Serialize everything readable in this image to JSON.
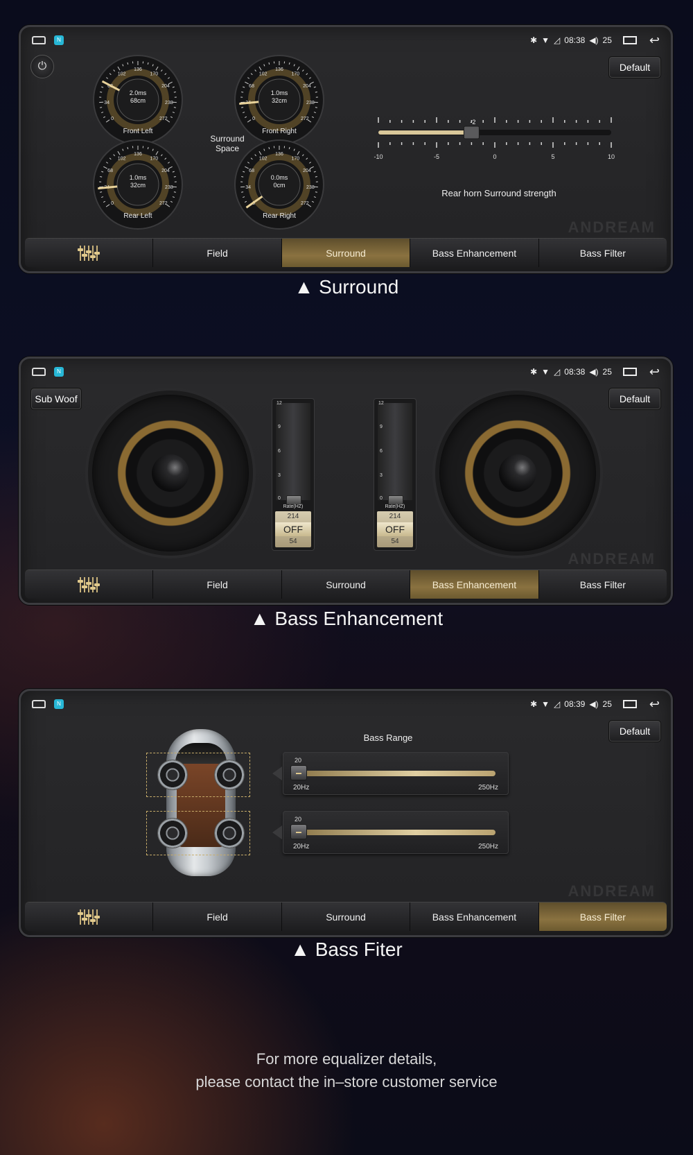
{
  "status": {
    "time_1": "08:38",
    "time_2": "08:38",
    "time_3": "08:39",
    "volume": "25",
    "app_icon_text": "N"
  },
  "common": {
    "default_label": "Default",
    "tabs": [
      "Field",
      "Surround",
      "Bass Enhancement",
      "Bass Filter"
    ],
    "watermark": "ANDREAM"
  },
  "surround": {
    "dials": [
      {
        "name": "Front Left",
        "time": "2.0ms",
        "distance": "68cm",
        "value": 68
      },
      {
        "name": "Front Right",
        "time": "1.0ms",
        "distance": "32cm",
        "value": 32
      },
      {
        "name": "Rear Left",
        "time": "1.0ms",
        "distance": "32cm",
        "value": 32
      },
      {
        "name": "Rear Right",
        "time": "0.0ms",
        "distance": "0cm",
        "value": 0
      }
    ],
    "dial_ticks": [
      "0",
      "34",
      "68",
      "102",
      "136",
      "170",
      "204",
      "238",
      "272"
    ],
    "space_label_line1": "Surround",
    "space_label_line2": "Space",
    "strength_value": "-2",
    "strength": -2,
    "strength_ticks": [
      "-10",
      "-5",
      "0",
      "5",
      "10"
    ],
    "strength_label": "Rear horn Surround strength"
  },
  "bass_enhancement": {
    "subwoof_label": "Sub Woof",
    "fader_ticks": [
      "12",
      "9",
      "6",
      "3",
      "0"
    ],
    "rate_label": "Rate(HZ)",
    "faders": [
      {
        "value": 0,
        "rate_above": "214",
        "rate_state": "OFF",
        "rate_below": "54"
      },
      {
        "value": 0,
        "rate_above": "214",
        "rate_state": "OFF",
        "rate_below": "54"
      }
    ]
  },
  "bass_filter": {
    "range_label": "Bass Range",
    "sliders": [
      {
        "value": "20",
        "min": "20Hz",
        "max": "250Hz"
      },
      {
        "value": "20",
        "min": "20Hz",
        "max": "250Hz"
      }
    ]
  },
  "captions": {
    "surround": "▲ Surround",
    "bass_enhancement": "▲ Bass Enhancement",
    "bass_filter": "▲ Bass Fiter"
  },
  "footer": {
    "line1": "For more equalizer details,",
    "line2": "please contact the in–store customer service"
  },
  "colors": {
    "accent_gold": "#8a7240",
    "panel_bg": "#262628",
    "zone_dash": "#c8ad6a"
  },
  "icons": [
    "home-icon",
    "app-icon",
    "bluetooth-icon",
    "wifi-icon",
    "signal-icon",
    "volume-icon",
    "recent-apps-icon",
    "back-icon",
    "power-icon",
    "equalizer-icon"
  ]
}
